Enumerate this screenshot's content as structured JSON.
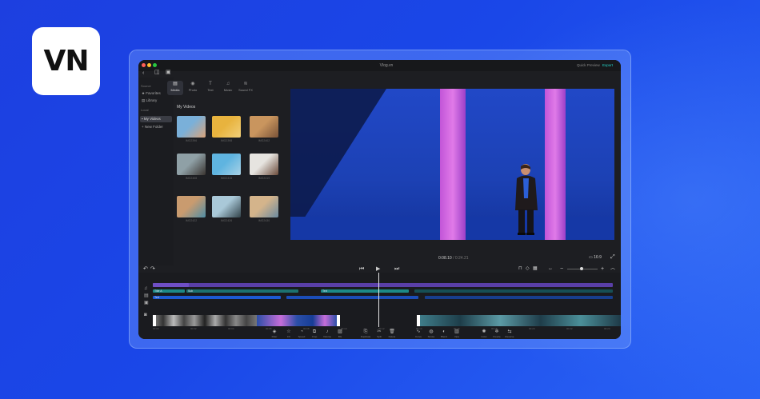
{
  "brand": {
    "logo_text": "VN"
  },
  "window": {
    "title": "Vlog.vn",
    "quick_preview": "Quick Preview",
    "export_label": "Export",
    "traffic_lights": [
      "#ff5f57",
      "#febc2e",
      "#28c840"
    ]
  },
  "sidebar": {
    "section_source": "Source",
    "favorites": "Favorites",
    "library": "Library",
    "section_local": "Local",
    "my_videos": "My Videos",
    "new_folder": "New Folder"
  },
  "media_tabs": [
    {
      "label": "Media",
      "icon": "film-icon"
    },
    {
      "label": "Photo",
      "icon": "photo-icon"
    },
    {
      "label": "Text",
      "icon": "text-icon"
    },
    {
      "label": "Music",
      "icon": "music-icon"
    },
    {
      "label": "Sound FX",
      "icon": "soundfx-icon"
    }
  ],
  "media": {
    "section_title": "My Videos",
    "items": [
      {
        "caption": "IMG2396",
        "duration": "",
        "colors": [
          "#7ab0d9",
          "#d9a37a"
        ]
      },
      {
        "caption": "IMG2398",
        "duration": "",
        "colors": [
          "#e8b33e",
          "#f2d07a"
        ]
      },
      {
        "caption": "IMG2402",
        "duration": "",
        "colors": [
          "#c9955e",
          "#7a5338"
        ]
      },
      {
        "caption": "IMG2408",
        "duration": "",
        "colors": [
          "#8fa0a6",
          "#3a3430"
        ]
      },
      {
        "caption": "IMG2415",
        "duration": "",
        "colors": [
          "#5fb4e0",
          "#a9d2e6"
        ]
      },
      {
        "caption": "IMG2419",
        "duration": "",
        "colors": [
          "#e6e4e0",
          "#6a4a3a"
        ]
      },
      {
        "caption": "IMG2422",
        "duration": "",
        "colors": [
          "#c99b6f",
          "#4f8ea6"
        ]
      },
      {
        "caption": "IMG2426",
        "duration": "",
        "colors": [
          "#a9c8d8",
          "#32434a"
        ]
      },
      {
        "caption": "IMG2430",
        "duration": "",
        "colors": [
          "#d4b48b",
          "#6b8aa0"
        ]
      }
    ]
  },
  "preview": {
    "current_time": "0:08.10",
    "total_time": " / 0:24.21",
    "ratio_label": "16:9"
  },
  "timeline": {
    "tracks": {
      "music_label": "Backgrounds",
      "text_label_1": "Title A",
      "text_label_2": "Sub",
      "text_label_3": "Text",
      "sticker_label": "Text"
    },
    "ruler": [
      "00:00",
      "00:02",
      "00:04",
      "00:06",
      "00:08",
      "00:10",
      "00:12",
      "00:14",
      "00:16",
      "00:18",
      "00:20",
      "00:22",
      "00:24"
    ]
  },
  "toolbar": [
    {
      "label": "Filter",
      "icon": "filter-icon"
    },
    {
      "label": "FX",
      "icon": "fx-icon"
    },
    {
      "label": "Speed",
      "icon": "speed-icon"
    },
    {
      "label": "Crop",
      "icon": "crop-icon"
    },
    {
      "label": "Volume",
      "icon": "volume-icon"
    },
    {
      "label": "BG",
      "icon": "bg-icon"
    },
    {
      "label": "Duplicate",
      "icon": "duplicate-icon"
    },
    {
      "label": "Split",
      "icon": "split-icon"
    },
    {
      "label": "Delete",
      "icon": "delete-icon"
    },
    {
      "label": "Curve",
      "icon": "curve-icon"
    },
    {
      "label": "Stroke",
      "icon": "stroke-icon"
    },
    {
      "label": "Blend",
      "icon": "blend-icon"
    },
    {
      "label": "Opa",
      "icon": "opacity-icon"
    },
    {
      "label": "Color",
      "icon": "color-icon"
    },
    {
      "label": "Freeze",
      "icon": "freeze-icon"
    },
    {
      "label": "Reverse",
      "icon": "reverse-icon"
    }
  ]
}
